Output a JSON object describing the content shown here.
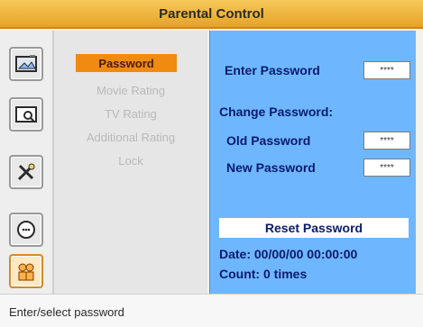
{
  "window": {
    "title": "Parental Control"
  },
  "sidebar": {
    "icons": [
      {
        "name": "picture-settings-icon",
        "active": false
      },
      {
        "name": "display-settings-icon",
        "active": false
      },
      {
        "name": "tools-icon",
        "active": false
      },
      {
        "name": "chat-icon",
        "active": false
      },
      {
        "name": "parental-icon",
        "active": true
      }
    ]
  },
  "menu": {
    "items": [
      {
        "label": "Password",
        "selected": true
      },
      {
        "label": "Movie Rating",
        "selected": false
      },
      {
        "label": "TV Rating",
        "selected": false
      },
      {
        "label": "Additional Rating",
        "selected": false
      },
      {
        "label": "Lock",
        "selected": false
      }
    ]
  },
  "panel": {
    "enter_password_label": "Enter Password",
    "enter_password_value": "****",
    "change_password_title": "Change Password:",
    "old_password_label": "Old Password",
    "old_password_value": "****",
    "new_password_label": "New Password",
    "new_password_value": "****",
    "reset_button_label": "Reset Password",
    "date_text": "Date: 00/00/00 00:00:00",
    "count_text": "Count: 0 times"
  },
  "footer": {
    "hint_text": "Enter/select password"
  }
}
